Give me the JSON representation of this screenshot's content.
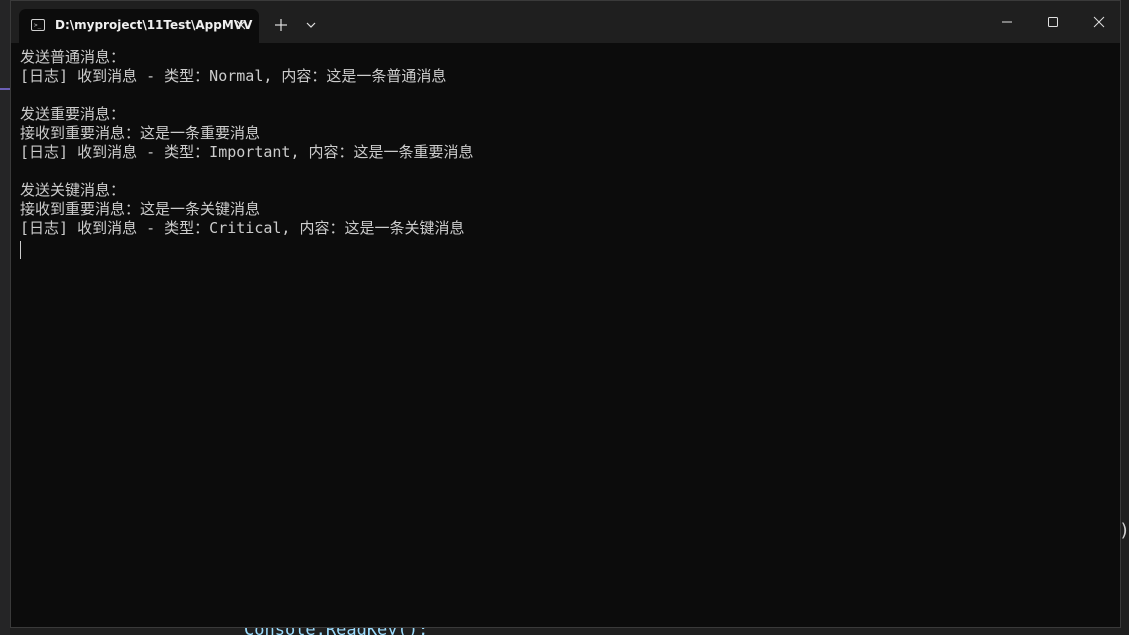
{
  "window": {
    "tab_title": "D:\\myproject\\11Test\\AppMVV",
    "tab_icon": "terminal-icon",
    "new_tab_icon": "plus-icon",
    "dropdown_icon": "chevron-down-icon",
    "minimize_icon": "minimize-icon",
    "maximize_icon": "maximize-icon",
    "close_icon": "close-icon"
  },
  "console": {
    "lines": [
      "发送普通消息：",
      "[日志] 收到消息 - 类型：Normal, 内容：这是一条普通消息",
      "",
      "发送重要消息：",
      "接收到重要消息：这是一条重要消息",
      "[日志] 收到消息 - 类型：Important, 内容：这是一条重要消息",
      "",
      "发送关键消息：",
      "接收到重要消息：这是一条关键消息",
      "[日志] 收到消息 - 类型：Critical, 内容：这是一条关键消息"
    ]
  },
  "background": {
    "code_fragment": "Console.ReadKey();",
    "paren": ")"
  },
  "colors": {
    "terminal_bg": "#0c0c0c",
    "titlebar_bg": "#1f1f1f",
    "text": "#cccccc"
  }
}
